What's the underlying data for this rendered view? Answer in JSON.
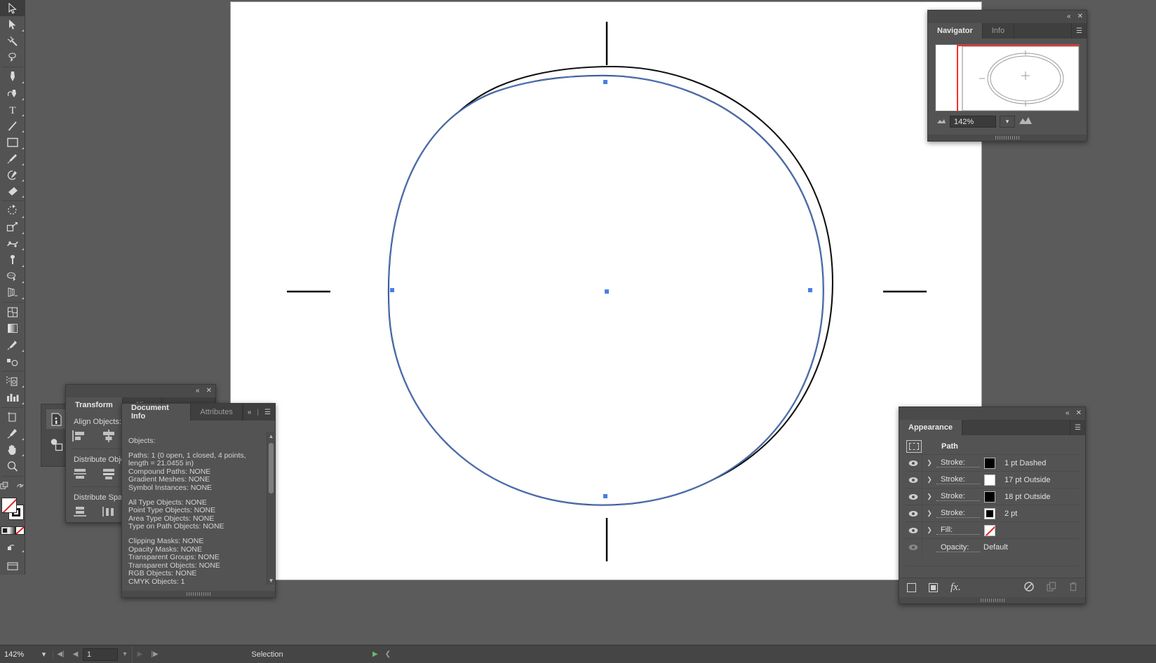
{
  "app": {
    "name": "Adobe Illustrator"
  },
  "toolbar": {
    "tools": [
      {
        "name": "selection-tool",
        "label": "Selection",
        "active": true
      },
      {
        "name": "direct-selection-tool",
        "label": "Direct Selection",
        "active": false
      },
      {
        "name": "magic-wand-tool",
        "label": "Magic Wand",
        "active": false
      },
      {
        "name": "lasso-tool",
        "label": "Lasso",
        "active": false
      },
      {
        "name": "pen-tool",
        "label": "Pen",
        "active": false
      },
      {
        "name": "curvature-tool",
        "label": "Curvature",
        "active": false
      },
      {
        "name": "type-tool",
        "label": "Type",
        "active": false
      },
      {
        "name": "line-segment-tool",
        "label": "Line Segment",
        "active": false
      },
      {
        "name": "rectangle-tool",
        "label": "Rectangle",
        "active": false
      },
      {
        "name": "paintbrush-tool",
        "label": "Paintbrush",
        "active": false
      },
      {
        "name": "shaper-tool",
        "label": "Shaper",
        "active": false
      },
      {
        "name": "eraser-tool",
        "label": "Eraser",
        "active": false
      },
      {
        "name": "rotate-tool",
        "label": "Rotate",
        "active": false
      },
      {
        "name": "scale-tool",
        "label": "Scale",
        "active": false
      },
      {
        "name": "width-tool",
        "label": "Width",
        "active": false
      },
      {
        "name": "free-transform-tool",
        "label": "Free Transform",
        "active": false
      },
      {
        "name": "shape-builder-tool",
        "label": "Shape Builder",
        "active": false
      },
      {
        "name": "perspective-grid-tool",
        "label": "Perspective Grid",
        "active": false
      },
      {
        "name": "mesh-tool",
        "label": "Mesh",
        "active": false
      },
      {
        "name": "gradient-tool",
        "label": "Gradient",
        "active": false
      },
      {
        "name": "eyedropper-tool",
        "label": "Eyedropper",
        "active": false
      },
      {
        "name": "blend-tool",
        "label": "Blend",
        "active": false
      },
      {
        "name": "symbol-sprayer-tool",
        "label": "Symbol Sprayer",
        "active": false
      },
      {
        "name": "column-graph-tool",
        "label": "Column Graph",
        "active": false
      },
      {
        "name": "artboard-tool",
        "label": "Artboard",
        "active": false
      },
      {
        "name": "slice-tool",
        "label": "Slice",
        "active": false
      },
      {
        "name": "hand-tool",
        "label": "Hand",
        "active": false
      },
      {
        "name": "zoom-tool",
        "label": "Zoom",
        "active": false
      }
    ],
    "fill_color": "#ffffff",
    "stroke_color": "#000000",
    "fill_is_none": true
  },
  "navigator": {
    "tabs": [
      {
        "label": "Navigator",
        "active": true
      },
      {
        "label": "Info",
        "active": false
      }
    ],
    "zoom_value": "142%",
    "view_box_color": "#ff2b2b"
  },
  "align_panel": {
    "tabs": [
      {
        "label": "Transform",
        "active": true
      },
      {
        "label": "Align",
        "active": false
      }
    ],
    "sections": [
      {
        "label": "Align Objects:"
      },
      {
        "label": "Distribute Objects:"
      },
      {
        "label": "Distribute Spacing:"
      }
    ]
  },
  "document_info": {
    "tabs": [
      {
        "label": "Document Info",
        "active": true
      },
      {
        "label": "Attributes",
        "active": false
      }
    ],
    "heading": "Objects:",
    "group1": [
      "Paths: 1 (0 open, 1 closed, 4 points, length = 21.0455 in)",
      "Compound Paths: NONE",
      "Gradient Meshes: NONE",
      "Symbol Instances: NONE"
    ],
    "group2": [
      "All Type Objects: NONE",
      "Point Type Objects: NONE",
      "Area Type Objects: NONE",
      "Type on Path Objects: NONE"
    ],
    "group3": [
      "Clipping Masks: NONE",
      "Opacity Masks: NONE",
      "Transparent Groups: NONE",
      "Transparent Objects: NONE",
      "RGB Objects: NONE",
      "CMYK Objects: 1"
    ]
  },
  "appearance": {
    "tabs": [
      {
        "label": "Appearance",
        "active": true
      }
    ],
    "object_type": "Path",
    "rows": [
      {
        "type": "stroke",
        "label": "Stroke:",
        "value": "1 pt Dashed",
        "chip": "black",
        "visible": true
      },
      {
        "type": "stroke",
        "label": "Stroke:",
        "value": "17 pt  Outside",
        "chip": "white",
        "visible": true
      },
      {
        "type": "stroke",
        "label": "Stroke:",
        "value": "18 pt  Outside",
        "chip": "black",
        "visible": true
      },
      {
        "type": "stroke",
        "label": "Stroke:",
        "value": "2 pt",
        "chip": "inner",
        "visible": true
      },
      {
        "type": "fill",
        "label": "Fill:",
        "value": "",
        "chip": "none",
        "visible": true
      },
      {
        "type": "opacity",
        "label": "Opacity:",
        "value": "Default",
        "chip": "",
        "visible": false
      }
    ],
    "footer_icons": [
      {
        "name": "add-new-stroke-icon"
      },
      {
        "name": "add-new-fill-icon"
      },
      {
        "name": "add-new-effect-icon"
      },
      {
        "name": "clear-appearance-icon"
      },
      {
        "name": "duplicate-item-icon"
      },
      {
        "name": "delete-item-icon"
      }
    ]
  },
  "status_bar": {
    "zoom_value": "142%",
    "page_value": "1",
    "status_text": "Selection"
  },
  "canvas": {
    "artboard_background": "#ffffff",
    "selection_color": "#4a7fe0",
    "stroke_color": "#000000",
    "crosshair_marks": 5
  }
}
